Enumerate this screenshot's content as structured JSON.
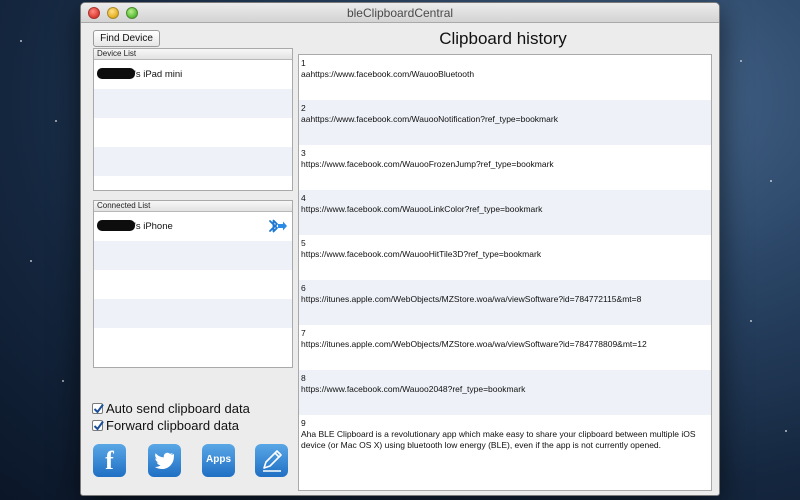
{
  "window": {
    "title": "bleClipboardCentral"
  },
  "toolbar": {
    "find_device_label": "Find Device"
  },
  "device_list": {
    "header": "Device List",
    "items": [
      {
        "label": "'s iPad mini"
      }
    ]
  },
  "connected_list": {
    "header": "Connected List",
    "items": [
      {
        "label": "'s iPhone",
        "icon": "bluetooth-forward-icon"
      }
    ]
  },
  "options": {
    "auto_send": {
      "label": "Auto send clipboard data",
      "checked": true
    },
    "forward": {
      "label": "Forward clipboard data",
      "checked": true
    }
  },
  "share": {
    "facebook_glyph": "f",
    "apps_label": "Apps"
  },
  "history": {
    "title": "Clipboard history",
    "entries": [
      {
        "index": "1",
        "text": "aahttps://www.facebook.com/WauooBluetooth"
      },
      {
        "index": "2",
        "text": "aahttps://www.facebook.com/WauooNotification?ref_type=bookmark"
      },
      {
        "index": "3",
        "text": "https://www.facebook.com/WauooFrozenJump?ref_type=bookmark"
      },
      {
        "index": "4",
        "text": "https://www.facebook.com/WauooLinkColor?ref_type=bookmark"
      },
      {
        "index": "5",
        "text": "https://www.facebook.com/WauooHitTile3D?ref_type=bookmark"
      },
      {
        "index": "6",
        "text": "https://itunes.apple.com/WebObjects/MZStore.woa/wa/viewSoftware?id=784772115&mt=8"
      },
      {
        "index": "7",
        "text": "https://itunes.apple.com/WebObjects/MZStore.woa/wa/viewSoftware?id=784778809&mt=12"
      },
      {
        "index": "8",
        "text": "https://www.facebook.com/Wauoo2048?ref_type=bookmark"
      },
      {
        "index": "9",
        "text": "Aha BLE Clipboard is a revolutionary app which make easy to share your clipboard between multiple iOS device (or Mac OS X) using bluetooth low energy (BLE), even if the app is not currently opened."
      }
    ]
  },
  "colors": {
    "accent": "#1f6fc4",
    "row_alt": "#eef2f8",
    "window_bg": "#ececec"
  }
}
